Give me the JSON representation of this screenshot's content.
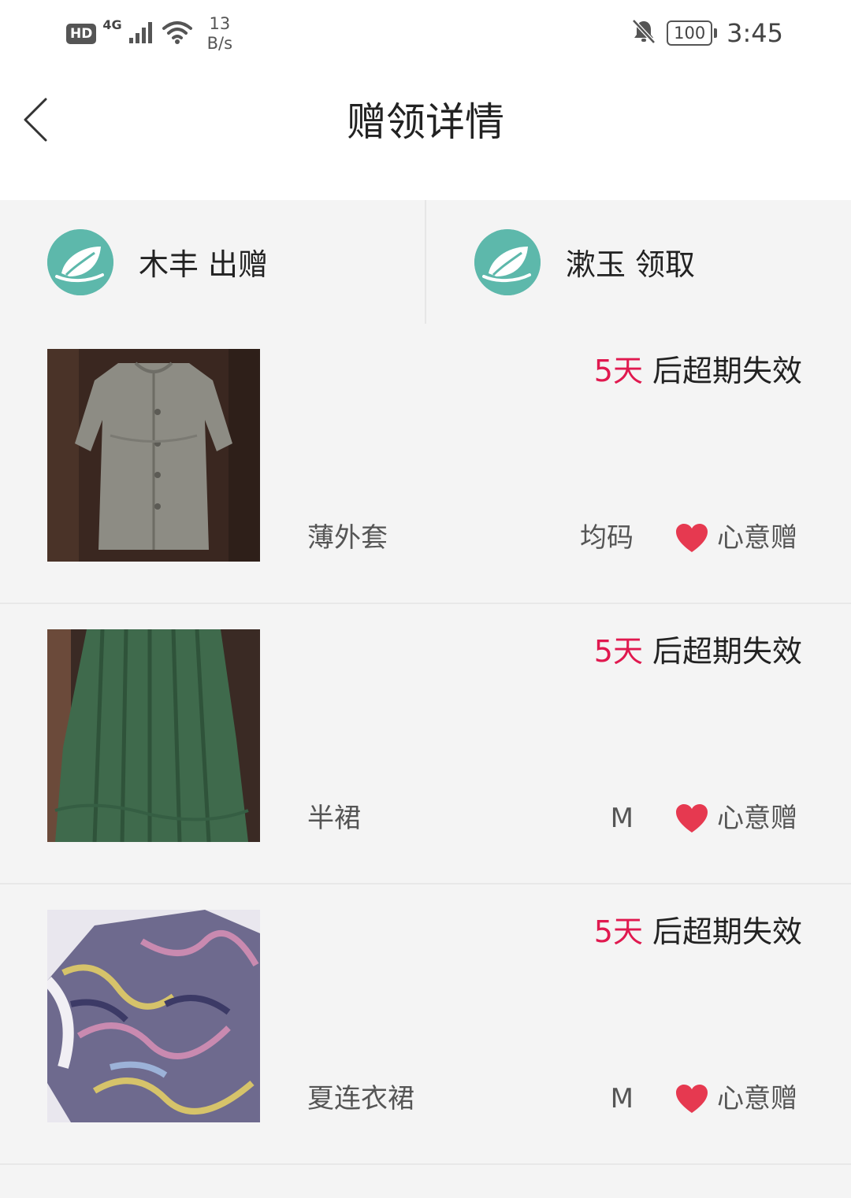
{
  "status_bar": {
    "hd": "HD",
    "network": "4G",
    "speed_value": "13",
    "speed_unit": "B/s",
    "battery": "100",
    "time": "3:45"
  },
  "header": {
    "title": "赠领详情"
  },
  "parties": {
    "giver": {
      "name": "木丰",
      "action": "出赠"
    },
    "receiver": {
      "name": "漱玉",
      "action": "领取"
    }
  },
  "items": [
    {
      "days": "5天",
      "expiry_suffix": "后超期失效",
      "name": "薄外套",
      "size": "均码",
      "gift_type": "心意赠"
    },
    {
      "days": "5天",
      "expiry_suffix": "后超期失效",
      "name": "半裙",
      "size": "M",
      "gift_type": "心意赠"
    },
    {
      "days": "5天",
      "expiry_suffix": "后超期失效",
      "name": "夏连衣裙",
      "size": "M",
      "gift_type": "心意赠"
    }
  ],
  "colors": {
    "accent_red": "#e0194f",
    "avatar_teal": "#5db8ab",
    "heart": "#e63950"
  }
}
